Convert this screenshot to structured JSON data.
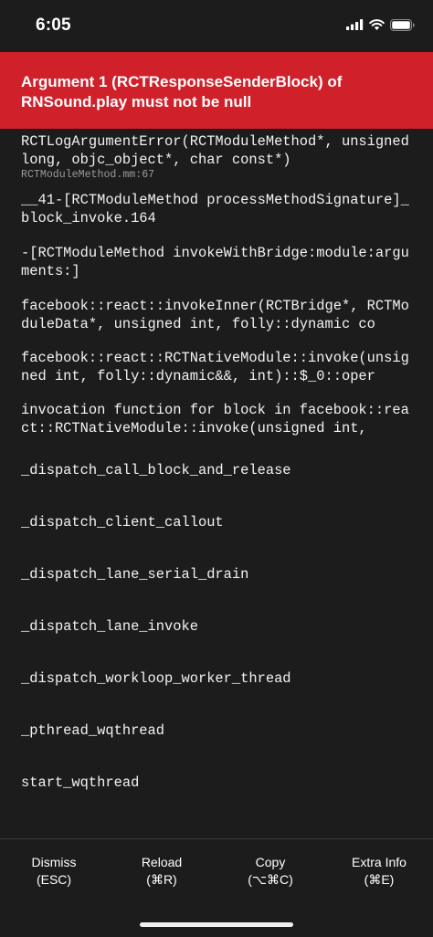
{
  "status_bar": {
    "time": "6:05",
    "icons": [
      "cellular-signal-icon",
      "wifi-icon",
      "battery-icon"
    ]
  },
  "error": {
    "message": "Argument 1 (RCTResponseSenderBlock) of RNSound.play must not be null",
    "banner_color": "#d0202a"
  },
  "stack": [
    {
      "text": "RCTLogArgumentError(RCTModuleMethod*, unsigned long, objc_object*, char const*)",
      "file": "RCTModuleMethod.mm:67"
    },
    {
      "text": "__41-[RCTModuleMethod processMethodSignature]_block_invoke.164"
    },
    {
      "text": "-[RCTModuleMethod invokeWithBridge:module:arguments:]"
    },
    {
      "text": "facebook::react::invokeInner(RCTBridge*, RCTModuleData*, unsigned int, folly::dynamic co"
    },
    {
      "text": "facebook::react::RCTNativeModule::invoke(unsigned int, folly::dynamic&&, int)::$_0::oper"
    },
    {
      "text": "invocation function for block in facebook::react::RCTNativeModule::invoke(unsigned int,"
    },
    {
      "text": "_dispatch_call_block_and_release"
    },
    {
      "text": "_dispatch_client_callout"
    },
    {
      "text": "_dispatch_lane_serial_drain"
    },
    {
      "text": "_dispatch_lane_invoke"
    },
    {
      "text": "_dispatch_workloop_worker_thread"
    },
    {
      "text": "_pthread_wqthread"
    },
    {
      "text": "start_wqthread"
    }
  ],
  "toolbar": {
    "dismiss": {
      "label": "Dismiss",
      "shortcut": "(ESC)"
    },
    "reload": {
      "label": "Reload",
      "shortcut": "(⌘R)"
    },
    "copy": {
      "label": "Copy",
      "shortcut": "(⌥⌘C)"
    },
    "extra_info": {
      "label": "Extra Info",
      "shortcut": "(⌘E)"
    }
  }
}
